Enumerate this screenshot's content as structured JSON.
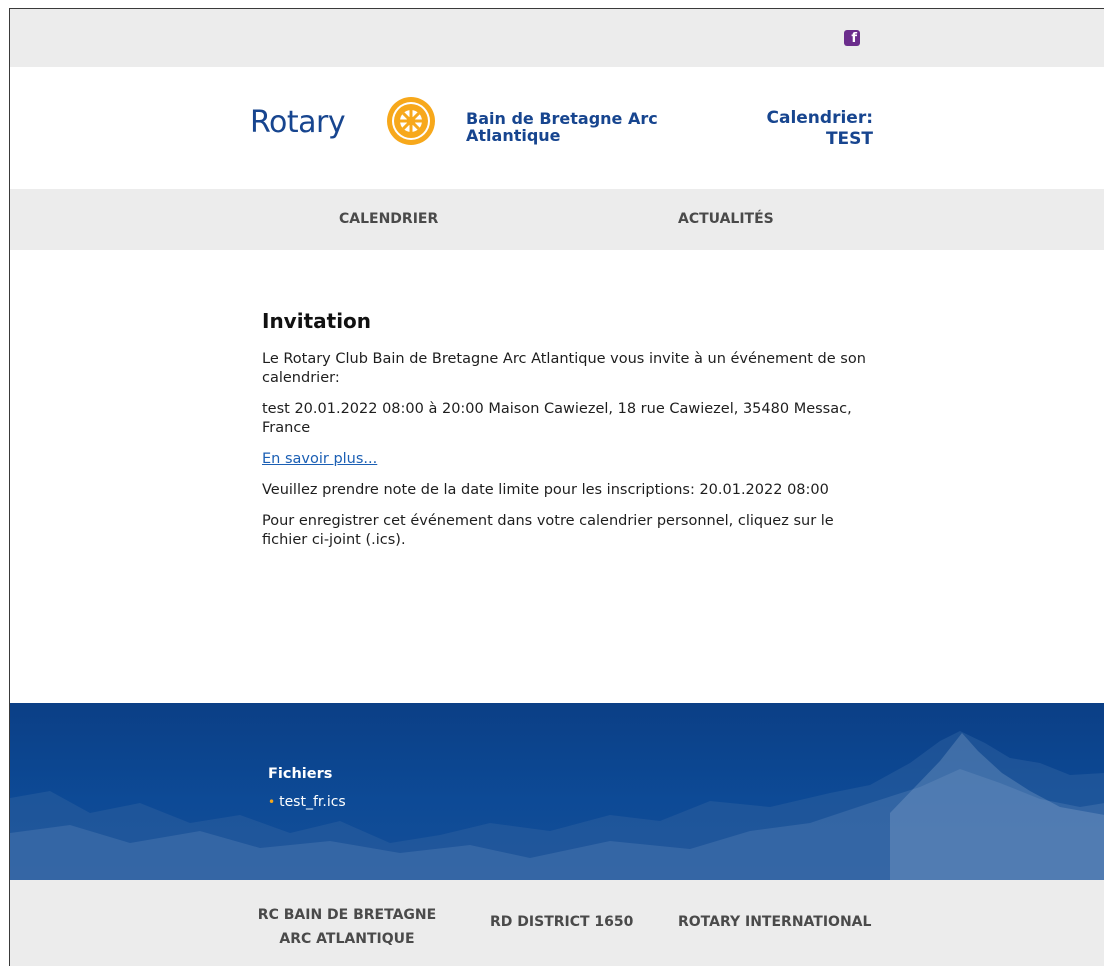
{
  "topbar": {
    "facebook_icon": "facebook-icon",
    "facebook_glyph": "f",
    "accent": "#6b2d8c"
  },
  "header": {
    "logo_word": "Rotary",
    "club_name": "Bain de Bretagne Arc Atlantique",
    "calendar_label": "Calendrier:",
    "calendar_name": "TEST",
    "brand_blue": "#17458f",
    "brand_gold": "#f7a81b"
  },
  "nav": {
    "items": [
      {
        "label": "CALENDRIER"
      },
      {
        "label": "ACTUALITÉS"
      }
    ]
  },
  "main": {
    "title": "Invitation",
    "intro": "Le Rotary Club Bain de Bretagne Arc Atlantique vous invite à un événement de son calendrier:",
    "event": "test 20.01.2022 08:00 à 20:00 Maison Cawiezel, 18 rue Cawiezel, 35480 Messac, France",
    "more_link": "En savoir plus...",
    "deadline": "Veuillez prendre note de la date limite pour les inscriptions: 20.01.2022 08:00",
    "ics_note": "Pour enregistrer cet événement dans votre calendrier personnel, cliquez sur le fichier ci-joint (.ics)."
  },
  "files": {
    "title": "Fichiers",
    "items": [
      {
        "name": "test_fr.ics"
      }
    ]
  },
  "footer": {
    "links": [
      {
        "line1": "RC BAIN DE BRETAGNE",
        "line2": "ARC ATLANTIQUE"
      },
      {
        "label": "RD DISTRICT 1650"
      },
      {
        "label": "ROTARY INTERNATIONAL"
      }
    ]
  }
}
